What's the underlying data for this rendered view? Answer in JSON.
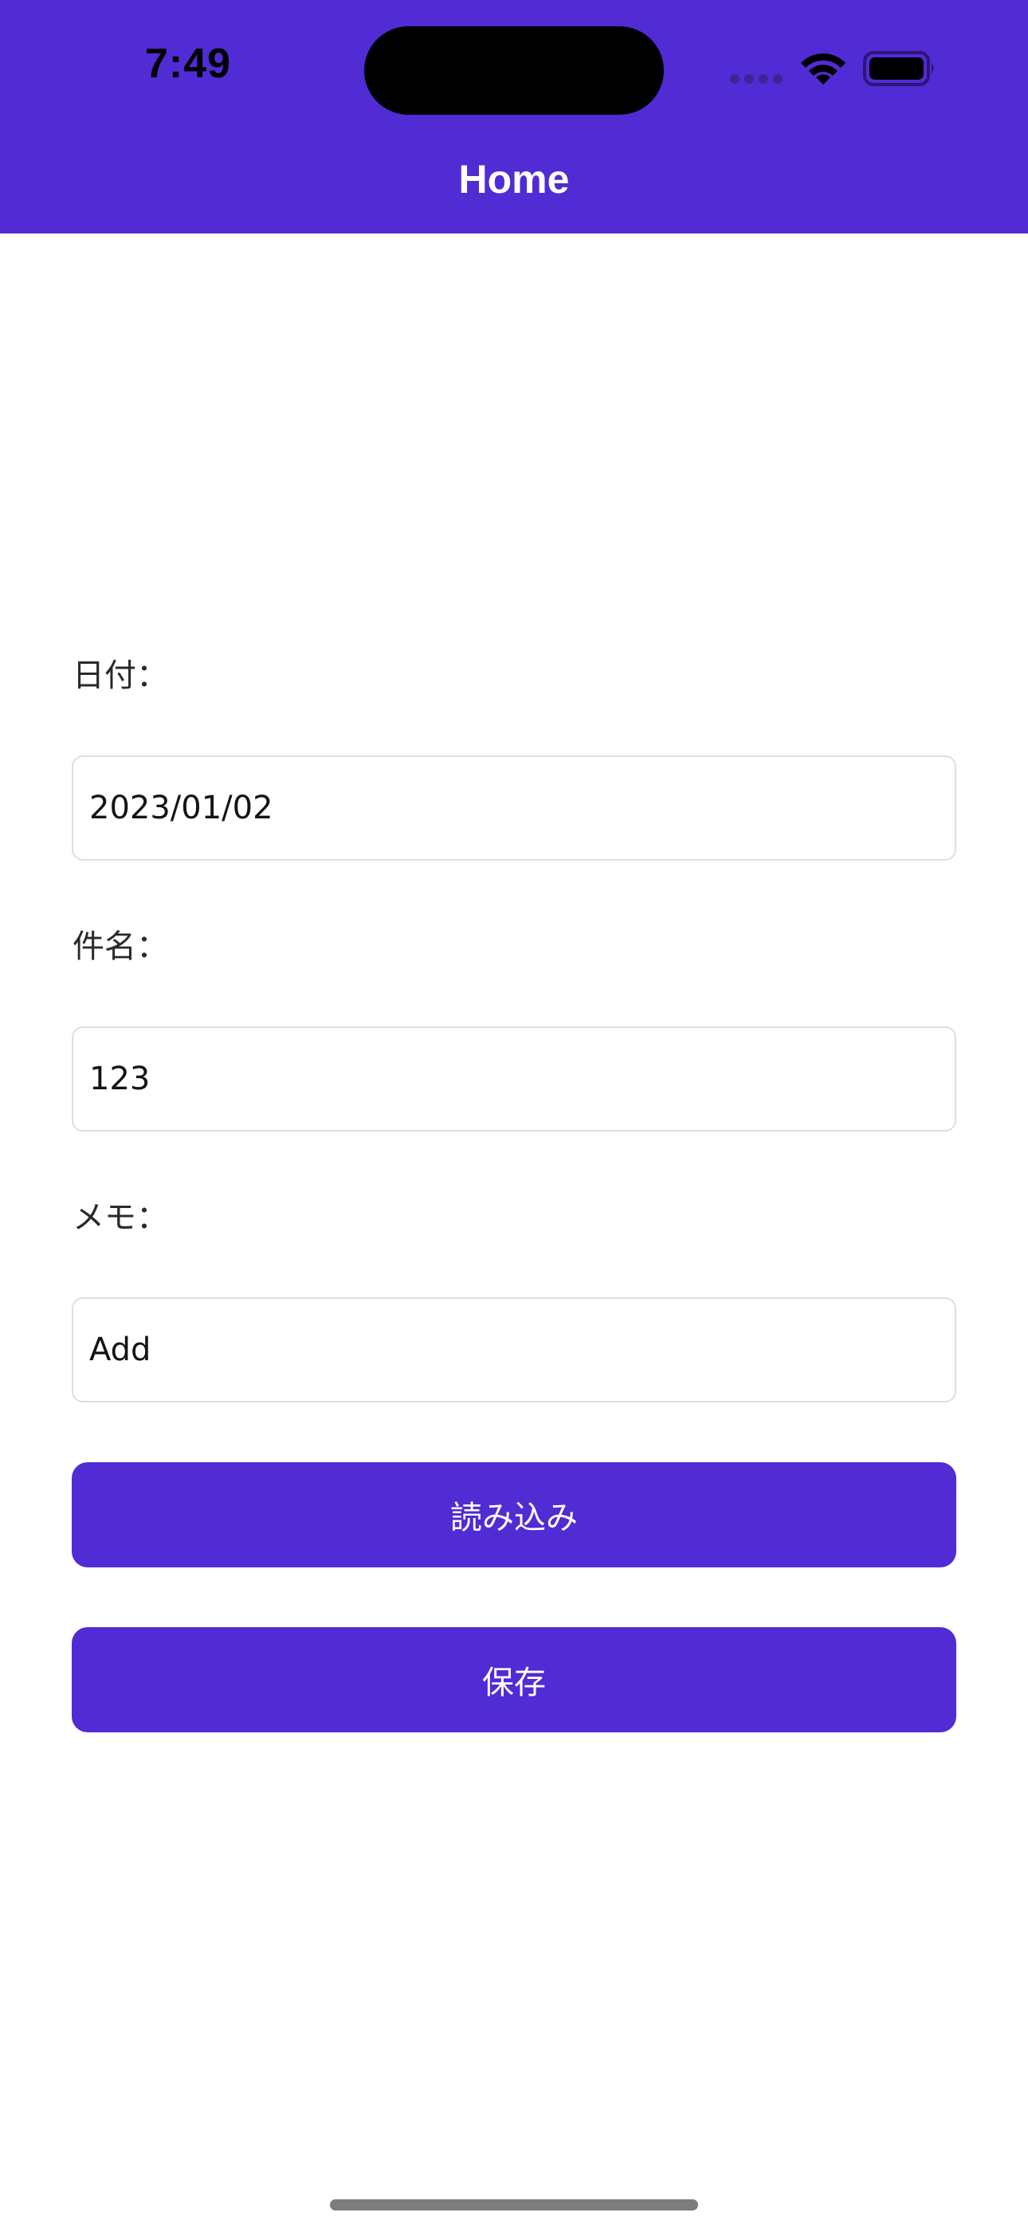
{
  "status_bar": {
    "time": "7:49"
  },
  "header": {
    "title": "Home"
  },
  "form": {
    "date_label": "日付：",
    "date_value": "2023/01/02",
    "subject_label": "件名：",
    "subject_value": "123",
    "memo_label": "メモ：",
    "memo_value": "Add"
  },
  "actions": {
    "load_label": "読み込み",
    "save_label": "保存"
  },
  "icons": {
    "signal": "cellular-signal-icon",
    "wifi": "wifi-icon",
    "battery": "battery-icon"
  },
  "colors": {
    "accent": "#512bd4",
    "background": "#ffffff",
    "input_border": "#dedede"
  }
}
